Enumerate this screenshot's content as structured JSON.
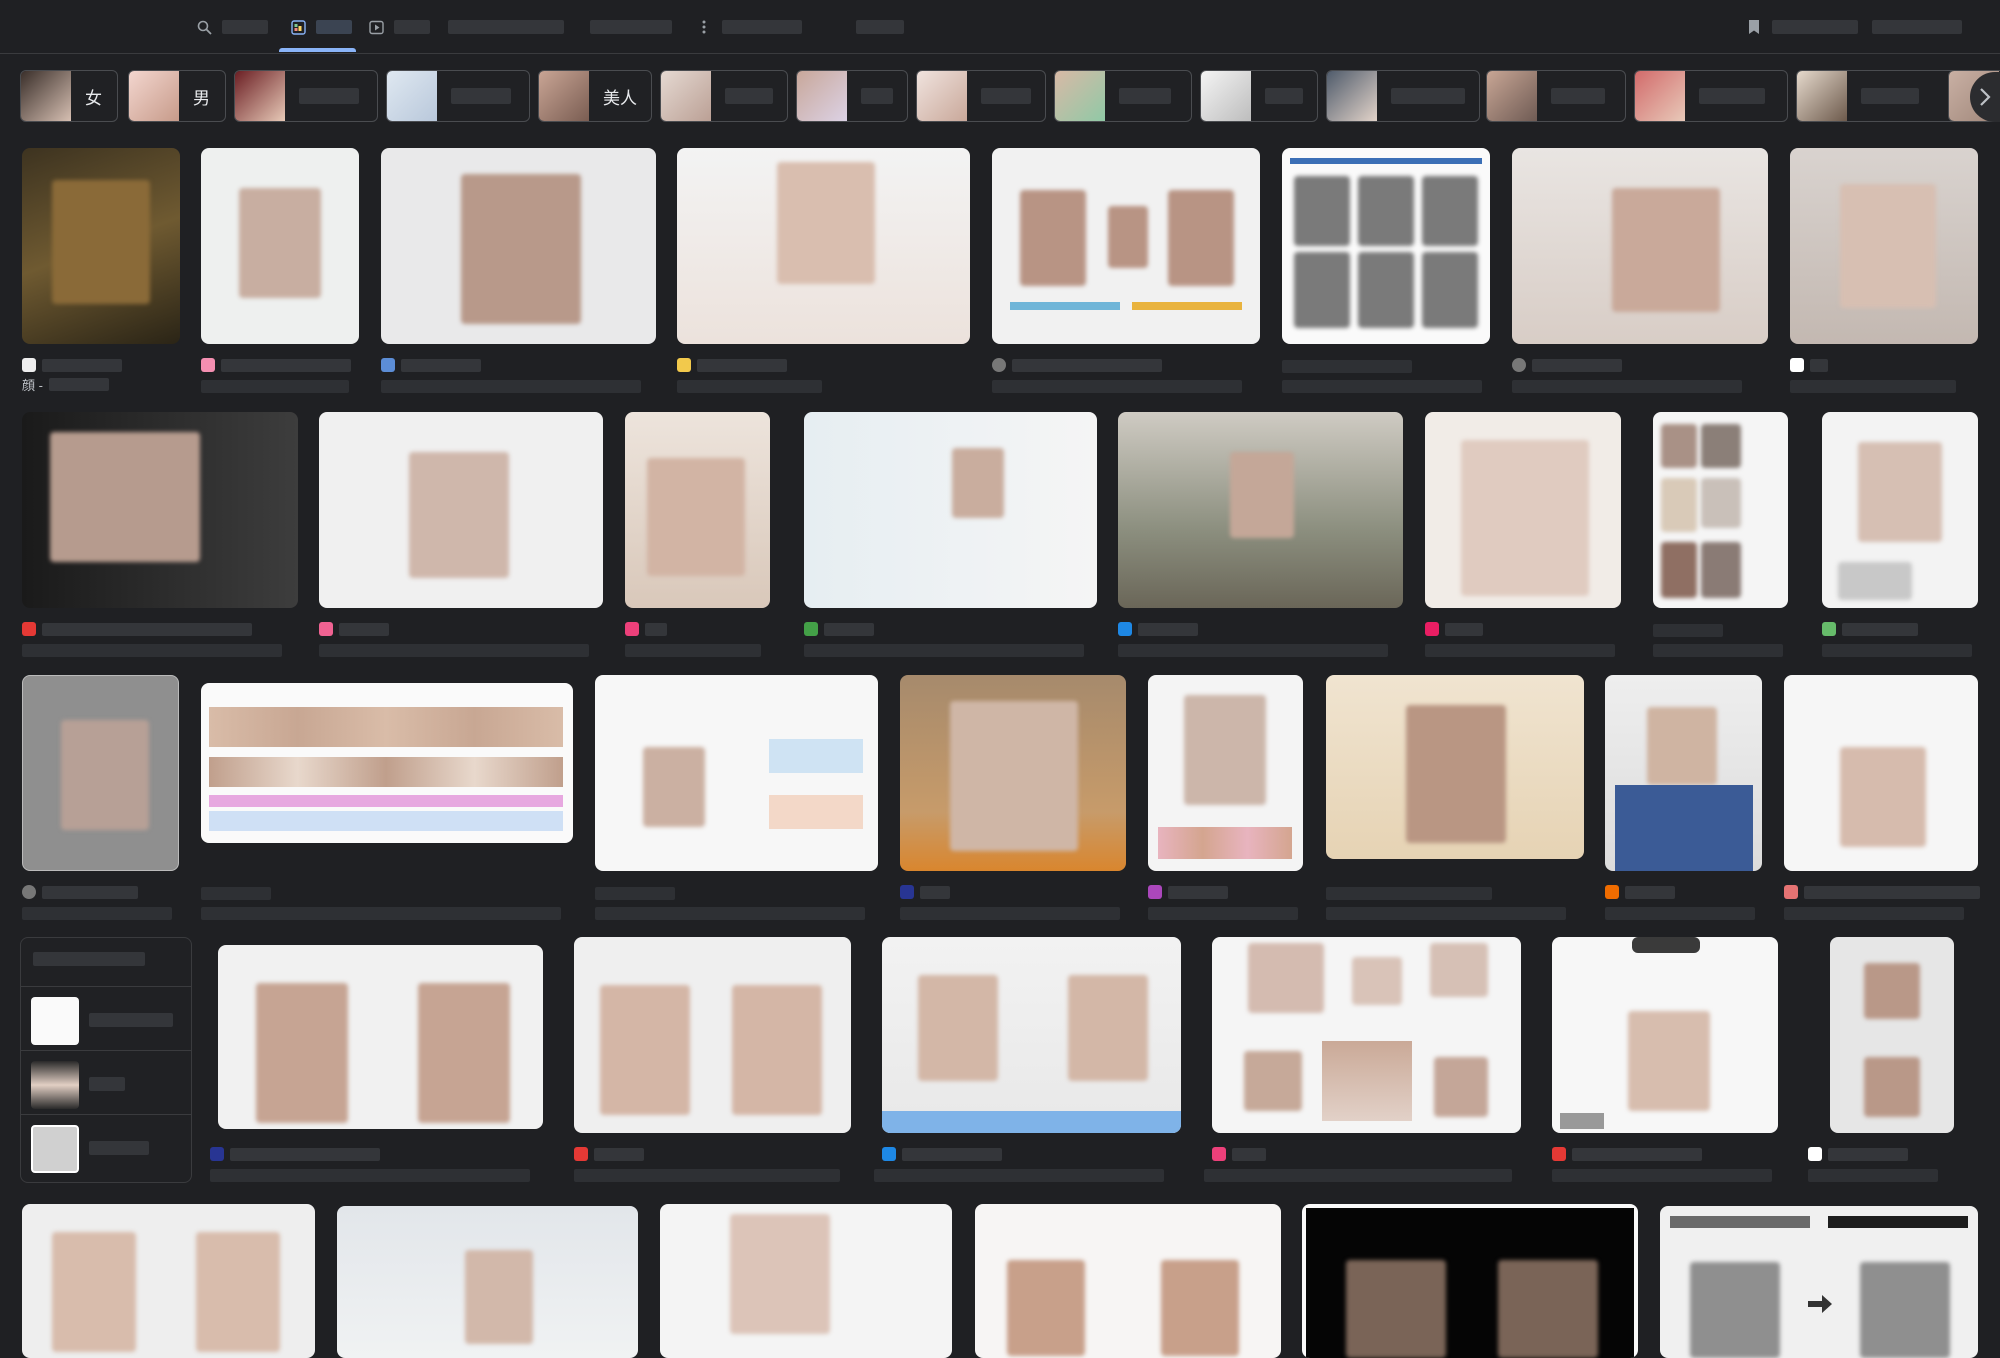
{
  "colors": {
    "background": "#1f2023",
    "accent": "#8ab4f8",
    "chip_border": "#4a4c50"
  },
  "tabs": [
    {
      "name": "tab-all",
      "icon": "search-icon"
    },
    {
      "name": "tab-images",
      "icon": "image-icon",
      "active": true
    },
    {
      "name": "tab-videos",
      "icon": "play-icon"
    },
    {
      "name": "tab-news"
    },
    {
      "name": "tab-shopping"
    },
    {
      "name": "tab-more",
      "icon": "more-vert-icon"
    },
    {
      "name": "tab-tools"
    }
  ],
  "header_right": {
    "icon": "bookmark-icon"
  },
  "chips": [
    {
      "label": "女"
    },
    {
      "label": "男"
    },
    {
      "label": ""
    },
    {
      "label": ""
    },
    {
      "label": "美人"
    },
    {
      "label": ""
    },
    {
      "label": ""
    },
    {
      "label": ""
    },
    {
      "label": ""
    },
    {
      "label": ""
    },
    {
      "label": ""
    },
    {
      "label": ""
    },
    {
      "label": ""
    },
    {
      "label": ""
    }
  ],
  "chips_next_icon": "chevron-right-icon",
  "results": {
    "row1_first_source_prefix": "顔 -"
  },
  "related_searches": {
    "icon": "related-searches"
  }
}
